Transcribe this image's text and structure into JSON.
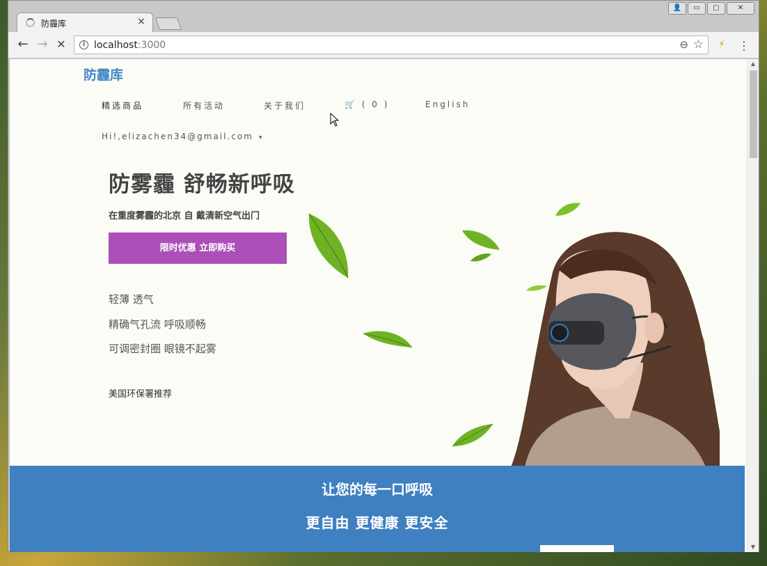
{
  "browser": {
    "tab_title": "防霾库",
    "tab_close": "×",
    "url_host": "localhost",
    "url_port": ":3000",
    "back": "←",
    "forward": "→",
    "stop": "✕",
    "info": "i",
    "zoom": "⊖",
    "star": "☆",
    "extension": "⚡",
    "menu": "⋮",
    "win_user": "👤",
    "win_min": "▭",
    "win_max": "▢",
    "win_close": "✕"
  },
  "site": {
    "brand": "防霾库",
    "nav": {
      "featured": "精选商品",
      "activities": "所有活动",
      "about": "关于我们",
      "cart": "🛒 ( 0 )",
      "language": "English"
    },
    "user_greeting": "Hi!,elizachen34@gmail.com",
    "user_caret": "▾"
  },
  "hero": {
    "title": "防雾霾  舒畅新呼吸",
    "subtitle": "在重度雾霾的北京   自 戴清新空气出门",
    "cta": "限时优惠 立即购买",
    "features": [
      "轻薄  透气",
      "精确气孔流  呼吸顺畅",
      "可调密封圈  眼镜不起雾"
    ],
    "recommend": "美国环保署推荐"
  },
  "banner": {
    "line1": "让您的每一口呼吸",
    "line2": "更自由  更健康  更安全"
  },
  "colors": {
    "brand": "#3f86c6",
    "cta": "#ac4fb8",
    "banner": "#3f80c0",
    "leaf": "#6fb324"
  }
}
